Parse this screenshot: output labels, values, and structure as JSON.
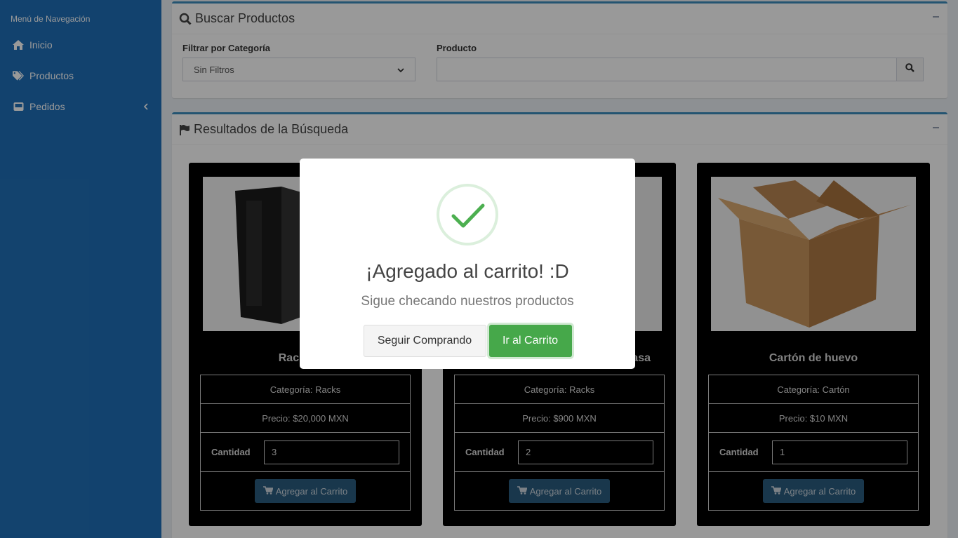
{
  "sidebar": {
    "header": "Menú de Navegación",
    "items": [
      {
        "label": "Inicio",
        "icon": "home-icon"
      },
      {
        "label": "Productos",
        "icon": "tags-icon"
      },
      {
        "label": "Pedidos",
        "icon": "inbox-icon",
        "has_submenu": true
      }
    ]
  },
  "search": {
    "title": "Buscar Productos",
    "category_label": "Filtrar por Categoría",
    "category_value": "Sin Filtros",
    "product_label": "Producto",
    "product_value": ""
  },
  "results": {
    "title": "Resultados de la Búsqueda",
    "qty_label": "Cantidad",
    "add_label": "Agregar al Carrito",
    "products": [
      {
        "name": "Rack para",
        "category": "Categoría: Racks",
        "price": "Precio: $20,000 MXN",
        "qty": "3"
      },
      {
        "name": "asa",
        "category": "Categoría: Racks",
        "price": "Precio: $900 MXN",
        "qty": "2"
      },
      {
        "name": "Cartón de huevo",
        "category": "Categoría: Cartón",
        "price": "Precio: $10 MXN",
        "qty": "1"
      }
    ]
  },
  "modal": {
    "title": "¡Agregado al carrito! :D",
    "text": "Sigue checando nuestros productos",
    "secondary_button": "Seguir Comprando",
    "primary_button": "Ir al Carrito"
  },
  "colors": {
    "sidebar": "#1f6fb8",
    "accent": "#3c8dbc",
    "success": "#46a84a"
  }
}
